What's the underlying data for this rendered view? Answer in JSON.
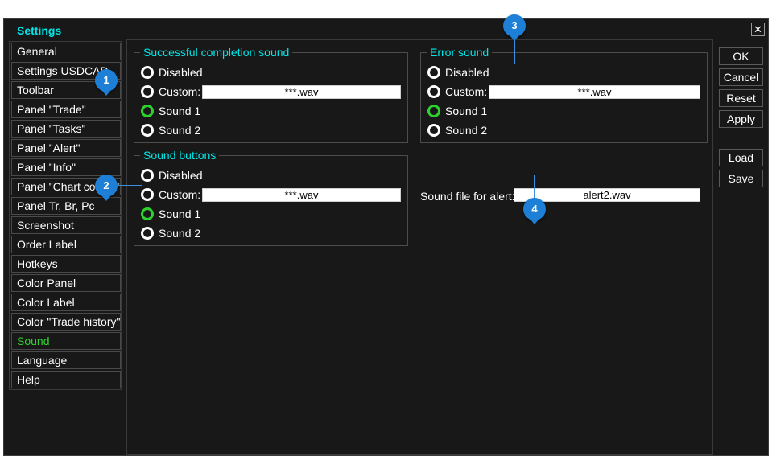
{
  "window": {
    "title": "Settings",
    "close_symbol": "✕"
  },
  "sidebar": {
    "items": [
      {
        "label": "General",
        "active": false
      },
      {
        "label": "Settings USDCAD",
        "active": false
      },
      {
        "label": "Toolbar",
        "active": false
      },
      {
        "label": "Panel \"Trade\"",
        "active": false
      },
      {
        "label": "Panel \"Tasks\"",
        "active": false
      },
      {
        "label": "Panel \"Alert\"",
        "active": false
      },
      {
        "label": "Panel \"Info\"",
        "active": false
      },
      {
        "label": "Panel \"Chart control\"",
        "active": false
      },
      {
        "label": "Panel Tr, Br, Pc",
        "active": false
      },
      {
        "label": "Screenshot",
        "active": false
      },
      {
        "label": "Order Label",
        "active": false
      },
      {
        "label": "Hotkeys",
        "active": false
      },
      {
        "label": "Color Panel",
        "active": false
      },
      {
        "label": "Color Label",
        "active": false
      },
      {
        "label": "Color \"Trade history\"",
        "active": false
      },
      {
        "label": "Sound",
        "active": true
      },
      {
        "label": "Language",
        "active": false
      },
      {
        "label": "Help",
        "active": false
      }
    ]
  },
  "success_sound": {
    "title": "Successful completion sound",
    "options": [
      "Disabled",
      "Custom:",
      "Sound 1",
      "Sound 2"
    ],
    "selected": "Sound 1",
    "custom_value": "***.wav"
  },
  "error_sound": {
    "title": "Error sound",
    "options": [
      "Disabled",
      "Custom:",
      "Sound 1",
      "Sound 2"
    ],
    "selected": "Sound 1",
    "custom_value": "***.wav"
  },
  "button_sounds": {
    "title": "Sound buttons",
    "options": [
      "Disabled",
      "Custom:",
      "Sound 1",
      "Sound 2"
    ],
    "selected": "Sound 1",
    "custom_value": "***.wav"
  },
  "alert": {
    "label": "Sound file for alert:",
    "value": "alert2.wav"
  },
  "buttons": {
    "ok": "OK",
    "cancel": "Cancel",
    "reset": "Reset",
    "apply": "Apply",
    "load": "Load",
    "save": "Save"
  },
  "callouts": [
    "1",
    "2",
    "3",
    "4"
  ],
  "colors": {
    "accent": "#00e5e5",
    "selected": "#2fd12f",
    "callout": "#1d7fd6",
    "background": "#181818"
  }
}
